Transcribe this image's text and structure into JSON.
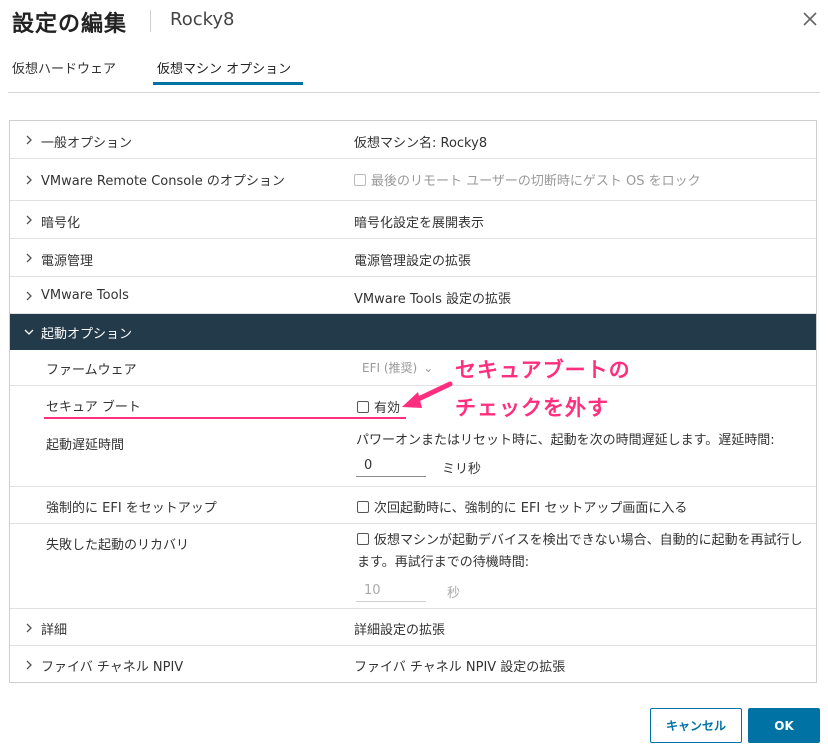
{
  "dialog": {
    "title": "設定の編集",
    "vm_name": "Rocky8"
  },
  "tabs": [
    {
      "label": "仮想ハードウェア",
      "active": false
    },
    {
      "label": "仮想マシン オプション",
      "active": true
    }
  ],
  "rows": {
    "general": {
      "label": "一般オプション",
      "value": "仮想マシン名: Rocky8"
    },
    "vmrc": {
      "label": "VMware Remote Console のオプション",
      "value": "最後のリモート ユーザーの切断時にゲスト OS をロック",
      "checked": false,
      "disabled": true
    },
    "encryption": {
      "label": "暗号化",
      "value": "暗号化設定を展開表示"
    },
    "power": {
      "label": "電源管理",
      "value": "電源管理設定の拡張"
    },
    "tools": {
      "label": "VMware Tools",
      "value": "VMware Tools 設定の拡張"
    },
    "boot": {
      "label": "起動オプション",
      "expanded": true
    },
    "firmware": {
      "label": "ファームウェア",
      "value": "EFI (推奨)"
    },
    "secure_boot": {
      "label": "セキュア ブート",
      "value": "有効",
      "checked": false
    },
    "boot_delay": {
      "label": "起動遅延時間",
      "description": "パワーオンまたはリセット時に、起動を次の時間遅延します。遅延時間:",
      "input_value": "0",
      "unit": "ミリ秒"
    },
    "force_efi": {
      "label": "強制的に EFI をセットアップ",
      "value": "次回起動時に、強制的に EFI セットアップ画面に入る",
      "checked": false
    },
    "failed_boot": {
      "label": "失敗した起動のリカバリ",
      "description": "仮想マシンが起動デバイスを検出できない場合、自動的に起動を再試行します。再試行までの待機時間:",
      "input_value": "10",
      "unit": "秒",
      "checked": false
    },
    "advanced": {
      "label": "詳細",
      "value": "詳細設定の拡張"
    },
    "npiv": {
      "label": "ファイバ チャネル NPIV",
      "value": "ファイバ チャネル NPIV 設定の拡張"
    }
  },
  "annotation": {
    "line1": "セキュアブートの",
    "line2": "チェックを外す",
    "color": "#ff2e7e"
  },
  "buttons": {
    "cancel": "キャンセル",
    "ok": "OK"
  },
  "colors": {
    "accent": "#0072a3",
    "active_row": "#223a4a"
  }
}
